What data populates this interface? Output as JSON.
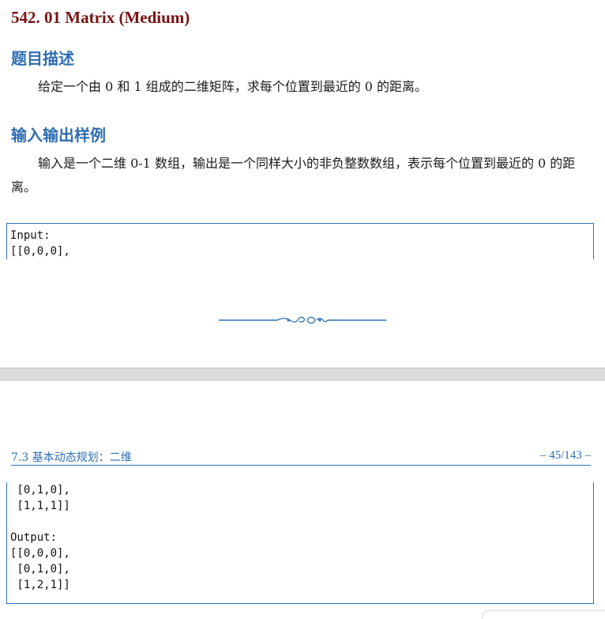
{
  "problem_title": "542. 01 Matrix (Medium)",
  "sections": [
    {
      "heading": "题目描述",
      "body": "给定一个由 0 和 1 组成的二维矩阵，求每个位置到最近的 0 的距离。"
    },
    {
      "heading": "输入输出样例",
      "body": "输入是一个二维 0-1 数组，输出是一个同样大小的非负整数数组，表示每个位置到最近的 0 的距离。"
    }
  ],
  "code_top": [
    "Input:",
    "[[0,0,0],"
  ],
  "running_header": {
    "section": "7.3 基本动态规划：二维",
    "page": "– 45/143 –"
  },
  "code_bottom": [
    " [0,1,0],",
    " [1,1,1]]",
    "",
    "Output:",
    "[[0,0,0],",
    " [0,1,0],",
    " [1,2,1]]"
  ],
  "colors": {
    "title": "#7a1212",
    "heading": "#2e6eb0",
    "rule": "#2e6eb0",
    "page_gap": "#dcdcdc"
  }
}
